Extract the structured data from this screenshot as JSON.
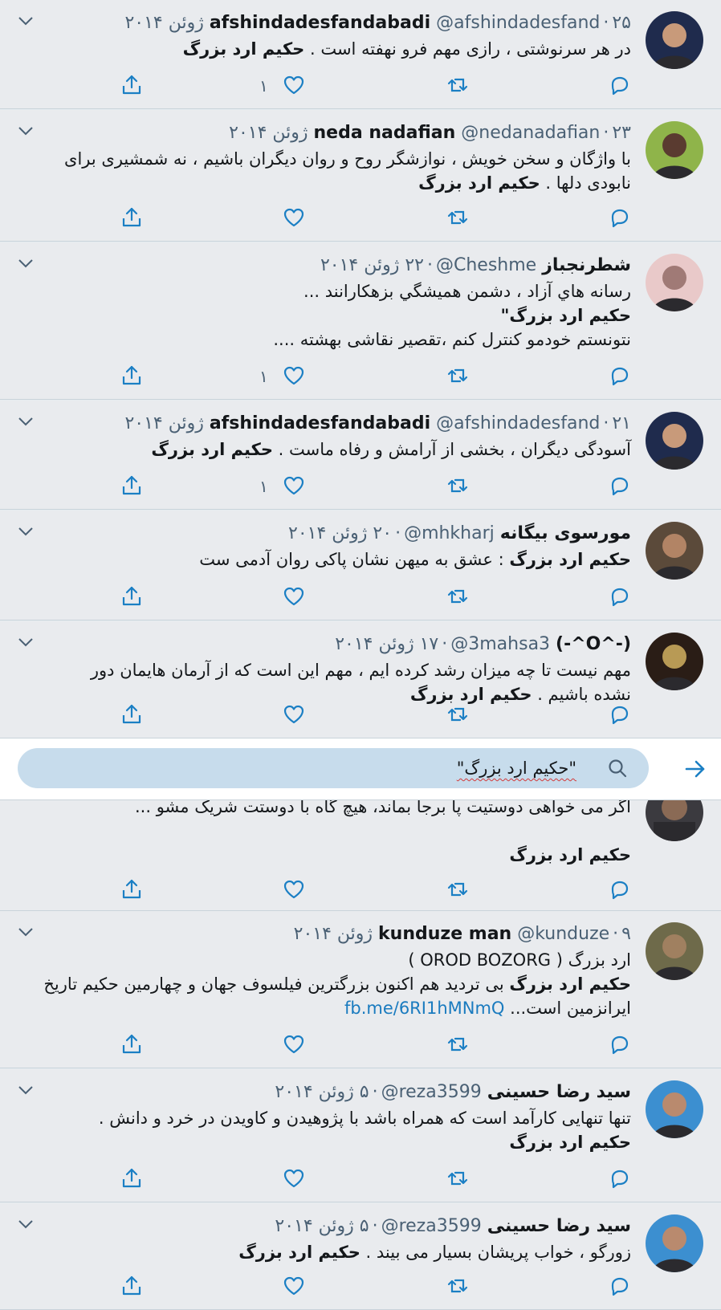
{
  "tweets": [
    {
      "name": "afshindadesfandabadi",
      "handle": "@afshindadesfand",
      "date": "۲۵ ژوئن ۲۰۱۴",
      "lines": [
        {
          "text": "در هر سرنوشتی ، رازی مهم فرو نهفته است . ",
          "bold": "حکیم ارد بزرگ"
        }
      ],
      "likes": "۱"
    },
    {
      "name": "neda nadafian",
      "handle": "@nedanadafian",
      "date": "۲۳ ژوئن ۲۰۱۴",
      "lines": [
        {
          "text": "با واژگان و سخن خویش ، نوازشگر روح و روان دیگران باشیم ، نه شمشیری برای",
          "bold": ""
        },
        {
          "text": "نابودی دلها .  ",
          "bold": "حکیم ارد بزرگ"
        }
      ],
      "likes": ""
    },
    {
      "name": "شطرنجباز",
      "handle": "@Cheshme",
      "date": "۲۲ ژوئن ۲۰۱۴",
      "lines": [
        {
          "text": "رسانه هاي آزاد ، دشمن هميشگي بزهکارانند ...",
          "bold": ""
        },
        {
          "text": "",
          "bold": "حکیم ارد بزرگ\""
        },
        {
          "text": "نتونستم خودمو کنترل کنم ،تقصیر نقاشی بهشته ....",
          "bold": ""
        }
      ],
      "likes": "۱"
    },
    {
      "name": "afshindadesfandabadi",
      "handle": "@afshindadesfand",
      "date": "۲۱ ژوئن ۲۰۱۴",
      "lines": [
        {
          "text": "آسودگی دیگران ، بخشی از آرامش و رفاه ماست .  ",
          "bold": "حکیم ارد بزرگ"
        }
      ],
      "likes": "۱"
    },
    {
      "name": "مورسوی بیگانه",
      "handle": "@mhkharj",
      "date": "۲۰ ژوئن ۲۰۱۴",
      "lines": [
        {
          "text": " : عشق به میهن نشان پاکی روان آدمی ست",
          "bold": "حکیم ارد بزرگ",
          "boldFirst": true
        }
      ],
      "likes": ""
    },
    {
      "name": "(-^O^-)",
      "handle": "@3mahsa3",
      "date": "۱۷ ژوئن ۲۰۱۴",
      "lines": [
        {
          "text": "مهم نیست تا چه میزان رشد کرده ایم ، مهم این است که از آرمان هایمان دور",
          "bold": ""
        },
        {
          "text": "نشده باشیم . ",
          "bold": "حکیم ارد بزرگ"
        }
      ],
      "likes": ""
    }
  ],
  "search": {
    "query": "\"حکیم ارد بزرگ\""
  },
  "partial_tweet": {
    "line": "اگر می خواهی دوستیت پا برجا بماند، هیچ گاه با دوستت شریک مشو ...",
    "bold": "حکیم ارد بزرگ"
  },
  "tweets2": [
    {
      "name": "kunduze man",
      "handle": "@kunduze",
      "date": "۹ ژوئن ۲۰۱۴",
      "lines": [
        {
          "text": "ارد بزرگ ( OROD BOZORG )",
          "bold": ""
        },
        {
          "text": " بی تردید هم اکنون بزرگترین فیلسوف جهان و چهارمین حکیم تاریخ",
          "bold": "حکیم ارد بزرگ",
          "boldFirst": true
        },
        {
          "text": "ایرانزمین است...",
          "bold": "",
          "link": "fb.me/6RI1hMNmQ"
        }
      ],
      "likes": ""
    },
    {
      "name": "سید رضا حسینی",
      "handle": "@reza3599",
      "date": "۵ ژوئن ۲۰۱۴",
      "lines": [
        {
          "text": "تنها تنهایی کارآمد است که همراه باشد با پژوهیدن و کاویدن در خرد و دانش .",
          "bold": ""
        },
        {
          "text": "",
          "bold": "حکیم ارد بزرگ"
        }
      ],
      "likes": ""
    },
    {
      "name": "سید رضا حسینی",
      "handle": "@reza3599",
      "date": "۵ ژوئن ۲۰۱۴",
      "lines": [
        {
          "text": "زورگو ، خواب پریشان بسیار می بیند . ",
          "bold": "حکیم ارد بزرگ"
        }
      ],
      "likes": ""
    }
  ],
  "colors": {
    "accent": "#1da1f2",
    "icon": "#1b7fc4",
    "search_bg": "#c7dcec"
  }
}
